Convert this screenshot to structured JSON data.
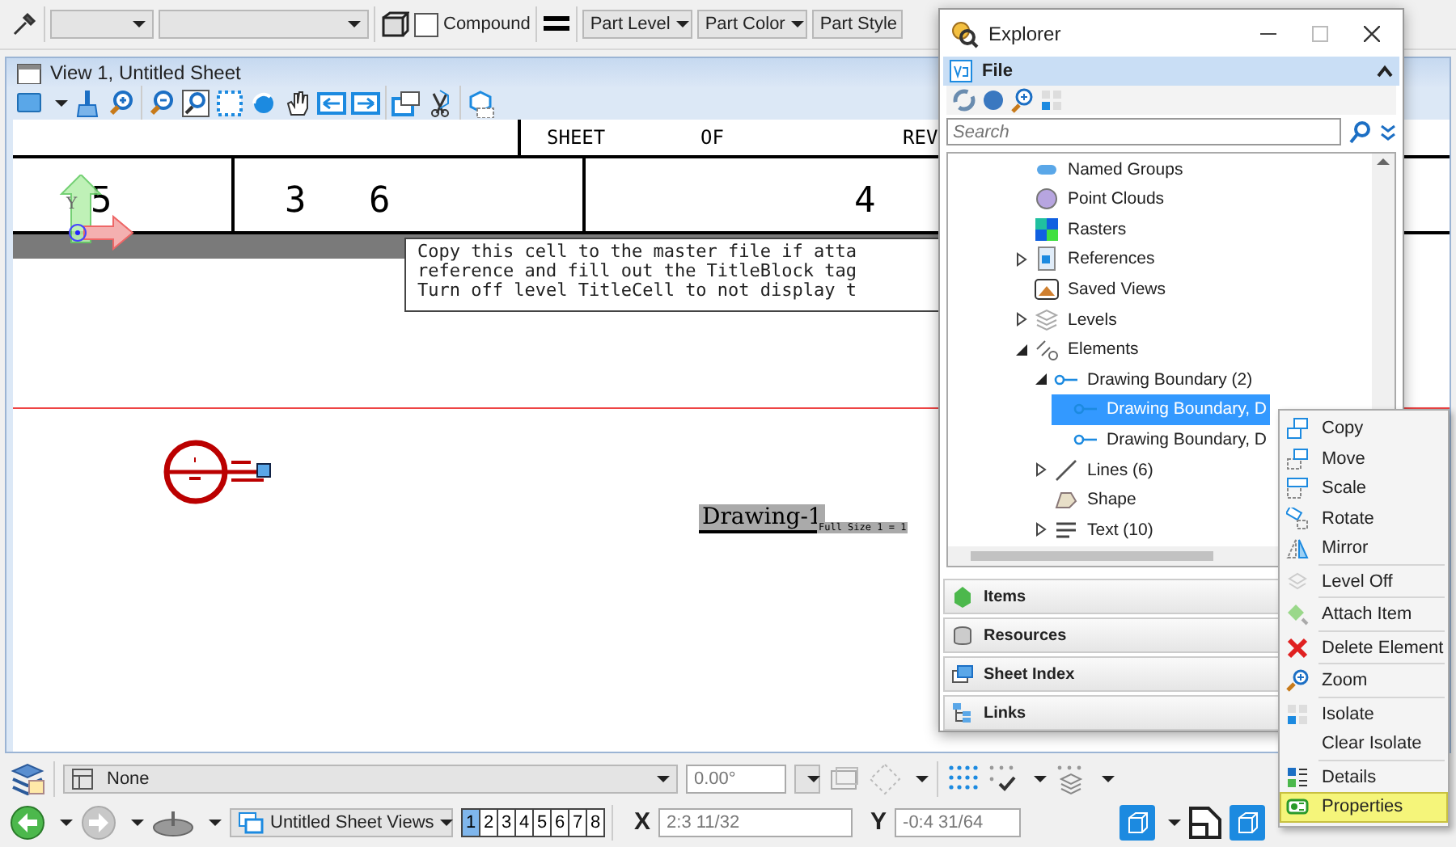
{
  "toolbar": {
    "compound": {
      "label": "Compound",
      "checked": false
    },
    "attribute_dropdowns": [
      "Part Level",
      "Part Color",
      "Part Style"
    ]
  },
  "view": {
    "title": "View 1, Untitled Sheet",
    "axis_label": "Y",
    "title_block": {
      "headers": [
        "SHEET",
        "OF",
        "REV"
      ],
      "values": [
        "5",
        "3",
        "6",
        "4"
      ],
      "note": [
        "Copy this cell to the master file if atta",
        "reference and fill out the TitleBlock tag",
        "Turn off level TitleCell to not display t"
      ],
      "drawing_label": "Drawing-1",
      "scale_label": "Full Size 1 = 1"
    }
  },
  "explorer": {
    "title": "Explorer",
    "section": "File",
    "search": {
      "placeholder": "Search"
    },
    "tree": [
      {
        "label": "Named Groups",
        "selected": false
      },
      {
        "label": "Point Clouds",
        "selected": false
      },
      {
        "label": "Rasters",
        "selected": false
      },
      {
        "label": "References",
        "selected": false,
        "expanded": false
      },
      {
        "label": "Saved Views",
        "selected": false
      },
      {
        "label": "Levels",
        "selected": false,
        "expanded": false
      },
      {
        "label": "Elements",
        "selected": false,
        "expanded": true,
        "children": [
          {
            "label": "Drawing Boundary (2)",
            "selected": false,
            "expanded": true,
            "children": [
              {
                "label": "Drawing Boundary, D",
                "selected": true
              },
              {
                "label": "Drawing Boundary, D",
                "selected": false
              }
            ]
          },
          {
            "label": "Lines (6)",
            "selected": false,
            "expanded": false
          },
          {
            "label": "Shape",
            "selected": false
          },
          {
            "label": "Text (10)",
            "selected": false,
            "expanded": false
          }
        ]
      }
    ],
    "panels": [
      "Items",
      "Resources",
      "Sheet Index",
      "Links"
    ]
  },
  "context_menu": [
    {
      "label": "Copy",
      "selected": false
    },
    {
      "label": "Move",
      "selected": false
    },
    {
      "label": "Scale",
      "selected": false
    },
    {
      "label": "Rotate",
      "selected": false
    },
    {
      "label": "Mirror",
      "selected": false,
      "separator_after": true
    },
    {
      "label": "Level Off",
      "selected": false,
      "separator_after": true
    },
    {
      "label": "Attach Item",
      "selected": false,
      "separator_after": true
    },
    {
      "label": "Delete Element",
      "selected": false,
      "separator_after": true
    },
    {
      "label": "Zoom",
      "selected": false,
      "separator_after": true
    },
    {
      "label": "Isolate",
      "selected": false
    },
    {
      "label": "Clear Isolate",
      "selected": false,
      "separator_after": true
    },
    {
      "label": "Details",
      "selected": false
    },
    {
      "label": "Properties",
      "selected": true
    }
  ],
  "bottom": {
    "level": "None",
    "angle": "0.00°",
    "sheet_views": "Untitled Sheet Views",
    "view_buttons": [
      {
        "label": "1",
        "selected": true
      },
      {
        "label": "2",
        "selected": false
      },
      {
        "label": "3",
        "selected": false
      },
      {
        "label": "4",
        "selected": false
      },
      {
        "label": "5",
        "selected": false
      },
      {
        "label": "6",
        "selected": false
      },
      {
        "label": "7",
        "selected": false
      },
      {
        "label": "8",
        "selected": false
      }
    ],
    "x": {
      "label": "X",
      "value": "2:3 11/32"
    },
    "y": {
      "label": "Y",
      "value": "-0:4 31/64"
    }
  }
}
